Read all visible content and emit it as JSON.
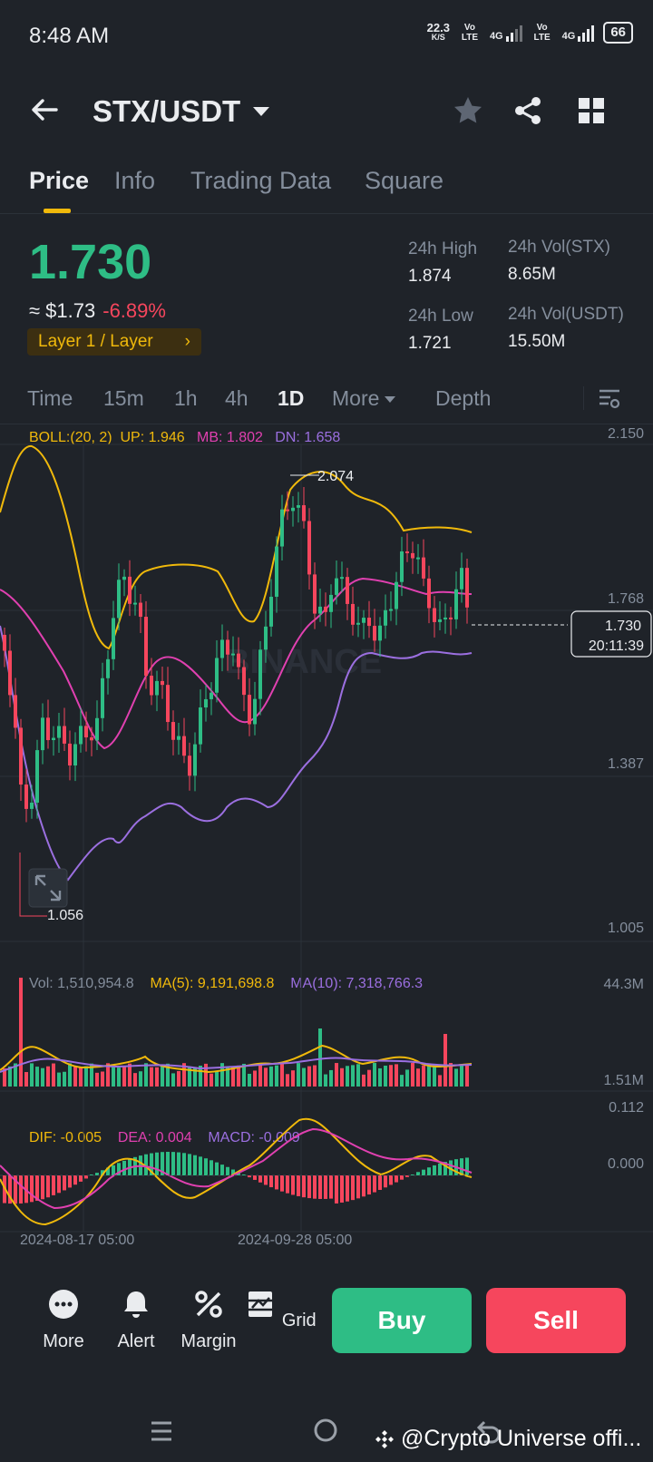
{
  "status": {
    "time": "8:48 AM",
    "speed": "22.3",
    "speed_unit": "K/S",
    "net1": "Vo LTE",
    "net2": "4G",
    "net3": "Vo LTE",
    "net4": "4G",
    "battery": "66"
  },
  "header": {
    "pair": "STX/USDT"
  },
  "tabs": [
    {
      "label": "Price"
    },
    {
      "label": "Info"
    },
    {
      "label": "Trading Data"
    },
    {
      "label": "Square"
    }
  ],
  "ticker": {
    "price": "1.730",
    "fiat": "≈ $1.73",
    "change": "-6.89%",
    "tag": "Layer 1 / Layer",
    "tag_arrow": "›",
    "high_label": "24h High",
    "high": "1.874",
    "low_label": "24h Low",
    "low": "1.721",
    "vol_stx_label": "24h Vol(STX)",
    "vol_stx": "8.65M",
    "vol_usdt_label": "24h Vol(USDT)",
    "vol_usdt": "15.50M"
  },
  "timeframes": [
    {
      "label": "Time"
    },
    {
      "label": "15m"
    },
    {
      "label": "1h"
    },
    {
      "label": "4h"
    },
    {
      "label": "1D"
    },
    {
      "label": "More"
    },
    {
      "label": "Depth"
    }
  ],
  "colors": {
    "up": "#2ebd85",
    "down": "#f6465d",
    "boll_up": "#f0b90b",
    "boll_mb": "#e040b0",
    "boll_dn": "#9b6fe0",
    "accent": "#f0b90b"
  },
  "chart": {
    "boll": {
      "label": "BOLL:(20, 2)",
      "up": "UP: 1.946",
      "mb": "MB: 1.802",
      "dn": "DN: 1.658"
    },
    "price_axis": [
      "2.150",
      "1.768",
      "1.387",
      "1.005"
    ],
    "high_marker": "2.074",
    "low_marker": "1.056",
    "last_price": "1.730",
    "countdown": "20:11:39",
    "watermark": "BINANCE",
    "volume": {
      "vol": "Vol: 1,510,954.8",
      "ma5": "MA(5): 9,191,698.8",
      "ma10": "MA(10): 7,318,766.3",
      "axis_top": "44.3M",
      "axis_bottom": "1.51M"
    },
    "macd": {
      "dif": "DIF: -0.005",
      "dea": "DEA: 0.004",
      "macd": "MACD: -0.009",
      "axis_top": "0.112",
      "axis_mid": "0.000"
    },
    "dates": [
      "2024-08-17 05:00",
      "2024-09-28 05:00"
    ]
  },
  "bottom_actions": [
    {
      "label": "More"
    },
    {
      "label": "Alert"
    },
    {
      "label": "Margin"
    },
    {
      "label": "Grid"
    }
  ],
  "buy_label": "Buy",
  "sell_label": "Sell",
  "watermark_text": "@Crypto Universe offi..."
}
